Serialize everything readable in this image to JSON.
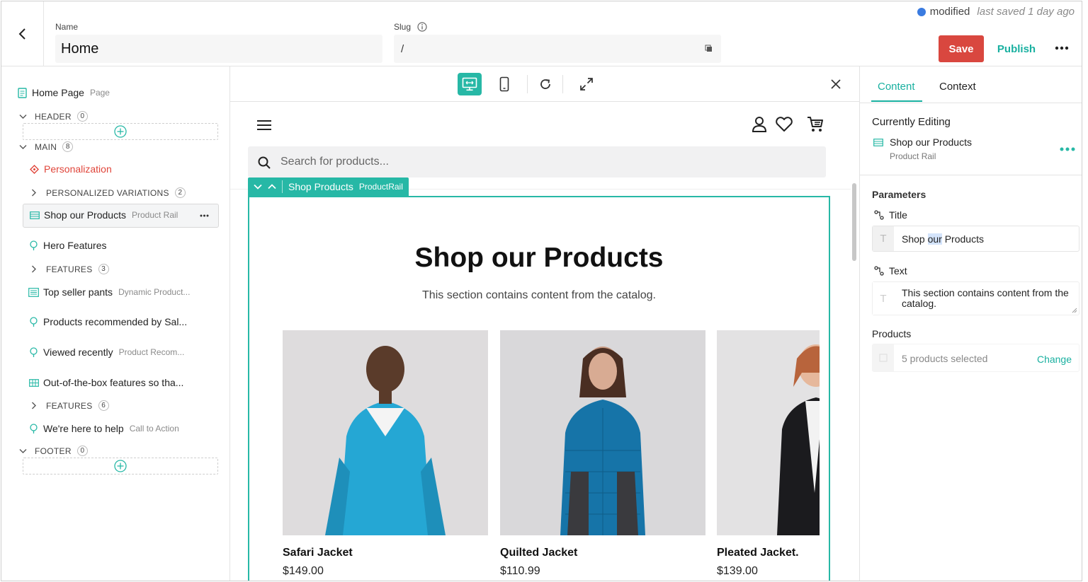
{
  "header": {
    "name_label": "Name",
    "name_value": "Home",
    "slug_label": "Slug",
    "slug_value": "/",
    "status_text": "modified",
    "last_saved": "last saved 1 day ago",
    "save_label": "Save",
    "publish_label": "Publish"
  },
  "sidebar": {
    "root": {
      "title": "Home Page",
      "type": "Page"
    },
    "header_section": {
      "label": "HEADER",
      "count": "0"
    },
    "main_section": {
      "label": "MAIN",
      "count": "8"
    },
    "personalization": "Personalization",
    "personalized_variations": {
      "label": "PERSONALIZED VARIATIONS",
      "count": "2"
    },
    "items": [
      {
        "title": "Shop our Products",
        "type": "Product Rail"
      },
      {
        "title": "Hero Features",
        "type": ""
      },
      {
        "title": "Top seller pants",
        "type": "Dynamic Product..."
      },
      {
        "title": "Products recommended by Sal...",
        "type": ""
      },
      {
        "title": "Viewed recently",
        "type": "Product Recom..."
      },
      {
        "title": "Out-of-the-box features so tha...",
        "type": ""
      },
      {
        "title": "We're here to help",
        "type": "Call to Action"
      }
    ],
    "features_1": {
      "label": "FEATURES",
      "count": "3"
    },
    "features_2": {
      "label": "FEATURES",
      "count": "6"
    },
    "footer_section": {
      "label": "FOOTER",
      "count": "0"
    }
  },
  "canvas": {
    "search_placeholder": "Search for products...",
    "component_tag": {
      "name": "Shop Products",
      "type": "ProductRail"
    },
    "rail_title": "Shop our Products",
    "rail_text": "This section contains content from the catalog.",
    "products": [
      {
        "name": "Safari Jacket",
        "price": "$149.00",
        "color": "#25a7d4"
      },
      {
        "name": "Quilted Jacket",
        "price": "$110.99",
        "color": "#1674a8"
      },
      {
        "name": "Pleated Jacket.",
        "price": "$139.00",
        "color": "#1b1b1e"
      }
    ]
  },
  "right_panel": {
    "tabs": [
      "Content",
      "Context"
    ],
    "currently_editing_label": "Currently Editing",
    "component_title": "Shop our Products",
    "component_type": "Product Rail",
    "parameters_label": "Parameters",
    "title_param": {
      "label": "Title",
      "value_before": "Shop ",
      "value_highlight": "our",
      "value_after": " Products"
    },
    "text_param": {
      "label": "Text",
      "value": "This section contains content from the catalog."
    },
    "products_param": {
      "label": "Products",
      "value": "5 products selected",
      "action": "Change"
    }
  },
  "colors": {
    "accent": "#19b0a0",
    "save": "#d9473f",
    "status_dot": "#3a7be0",
    "personalization": "#e0453a"
  }
}
